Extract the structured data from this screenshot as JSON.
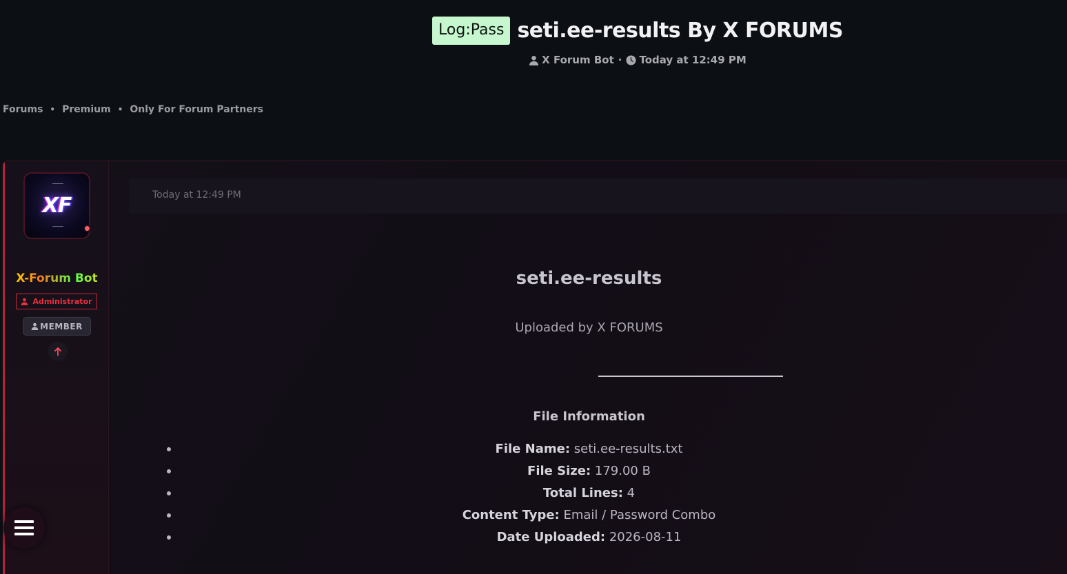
{
  "header": {
    "prefix": "Log:Pass",
    "title": "seti.ee-results By X FORUMS",
    "author": "X Forum Bot",
    "separator": "·",
    "date": "Today at 12:49 PM"
  },
  "breadcrumb": {
    "items": [
      "Forums",
      "Premium",
      "Only For Forum Partners"
    ],
    "separator": "•"
  },
  "user": {
    "avatar_text": "XF",
    "username": "X-Forum Bot",
    "role_admin": "Administrator",
    "role_member": "MEMBER",
    "online_color": "#ff5b6b"
  },
  "post": {
    "date": "Today at 12:49 PM",
    "title": "seti.ee-results",
    "uploaded_by": "Uploaded by X FORUMS",
    "section_title": "File Information",
    "info": [
      {
        "label": "File Name:",
        "value": "seti.ee-results.txt"
      },
      {
        "label": "File Size:",
        "value": "179.00 B"
      },
      {
        "label": "Total Lines:",
        "value": "4"
      },
      {
        "label": "Content Type:",
        "value": "Email / Password Combo"
      },
      {
        "label": "Date Uploaded:",
        "value": "2026-08-11"
      }
    ]
  },
  "colors": {
    "background": "#0c0f14",
    "prefix_bg": "#c6f7cf",
    "accent": "#b5213e",
    "admin": "#e83040"
  },
  "icons": {
    "user": "user-icon",
    "clock": "clock-icon",
    "menu": "menu-icon",
    "arrow_up": "arrow-up-icon"
  }
}
